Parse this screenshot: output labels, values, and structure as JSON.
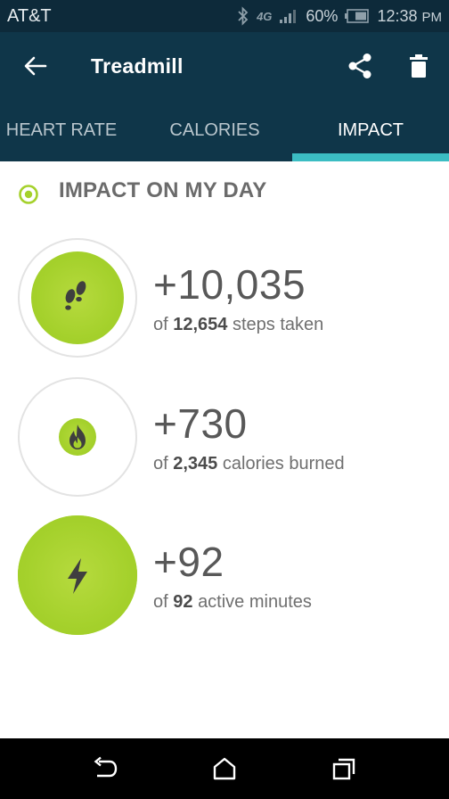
{
  "status_bar": {
    "carrier": "AT&T",
    "network": "4G",
    "battery": "60%",
    "time": "12:38",
    "ampm": "PM"
  },
  "app_bar": {
    "title": "Treadmill"
  },
  "tabs": [
    {
      "label": "HEART RATE",
      "active": false
    },
    {
      "label": "CALORIES",
      "active": false
    },
    {
      "label": "IMPACT",
      "active": true
    }
  ],
  "section": {
    "title": "IMPACT ON MY DAY"
  },
  "impacts": [
    {
      "delta": "+10,035",
      "prefix": "of",
      "total": "12,654",
      "suffix": "steps taken",
      "icon": "footsteps-icon",
      "fraction": 0.79
    },
    {
      "delta": "+730",
      "prefix": "of",
      "total": "2,345",
      "suffix": "calories burned",
      "icon": "flame-icon",
      "fraction": 0.31
    },
    {
      "delta": "+92",
      "prefix": "of",
      "total": "92",
      "suffix": "active minutes",
      "icon": "lightning-icon",
      "fraction": 1.0
    }
  ],
  "colors": {
    "app_bar": "#0f3649",
    "status_bar": "#0d2a3a",
    "tab_indicator": "#3bbdc3",
    "accent_green": "#a5d12c"
  }
}
